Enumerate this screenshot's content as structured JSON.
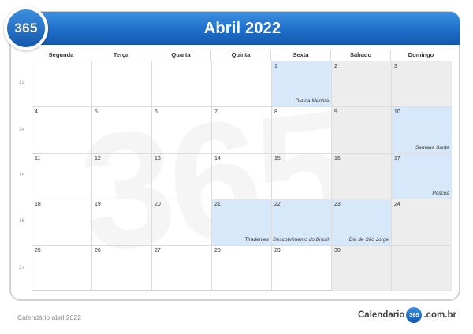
{
  "header": {
    "title": "Abril 2022",
    "logo_number": "365",
    "brand_color": "#1f6fcb"
  },
  "watermark": {
    "text": "365"
  },
  "weekdays": [
    "Segunda",
    "Terça",
    "Quarta",
    "Quinta",
    "Sexta",
    "Sábado",
    "Domingo"
  ],
  "weeks": [
    {
      "number": "13",
      "days": [
        {
          "day": "",
          "type": "empty",
          "event": ""
        },
        {
          "day": "",
          "type": "empty",
          "event": ""
        },
        {
          "day": "",
          "type": "empty",
          "event": ""
        },
        {
          "day": "",
          "type": "empty",
          "event": ""
        },
        {
          "day": "1",
          "type": "holiday",
          "event": "Dia da Mentira"
        },
        {
          "day": "2",
          "type": "weekend",
          "event": ""
        },
        {
          "day": "3",
          "type": "weekend",
          "event": ""
        }
      ]
    },
    {
      "number": "14",
      "days": [
        {
          "day": "4",
          "type": "normal",
          "event": ""
        },
        {
          "day": "5",
          "type": "normal",
          "event": ""
        },
        {
          "day": "6",
          "type": "normal",
          "event": ""
        },
        {
          "day": "7",
          "type": "normal",
          "event": ""
        },
        {
          "day": "8",
          "type": "normal",
          "event": ""
        },
        {
          "day": "9",
          "type": "weekend",
          "event": ""
        },
        {
          "day": "10",
          "type": "holiday",
          "event": "Semana Santa"
        }
      ]
    },
    {
      "number": "15",
      "days": [
        {
          "day": "11",
          "type": "normal",
          "event": ""
        },
        {
          "day": "12",
          "type": "normal",
          "event": ""
        },
        {
          "day": "13",
          "type": "normal",
          "event": ""
        },
        {
          "day": "14",
          "type": "normal",
          "event": ""
        },
        {
          "day": "15",
          "type": "normal",
          "event": ""
        },
        {
          "day": "16",
          "type": "weekend",
          "event": ""
        },
        {
          "day": "17",
          "type": "holiday",
          "event": "Páscoa"
        }
      ]
    },
    {
      "number": "16",
      "days": [
        {
          "day": "18",
          "type": "normal",
          "event": ""
        },
        {
          "day": "19",
          "type": "normal",
          "event": ""
        },
        {
          "day": "20",
          "type": "normal",
          "event": ""
        },
        {
          "day": "21",
          "type": "holiday",
          "event": "Tiradentes"
        },
        {
          "day": "22",
          "type": "holiday",
          "event": "Descobrimento do Brasil"
        },
        {
          "day": "23",
          "type": "holiday",
          "event": "Dia de São Jorge"
        },
        {
          "day": "24",
          "type": "weekend",
          "event": ""
        }
      ]
    },
    {
      "number": "17",
      "days": [
        {
          "day": "25",
          "type": "normal",
          "event": ""
        },
        {
          "day": "26",
          "type": "normal",
          "event": ""
        },
        {
          "day": "27",
          "type": "normal",
          "event": ""
        },
        {
          "day": "28",
          "type": "normal",
          "event": ""
        },
        {
          "day": "29",
          "type": "normal",
          "event": ""
        },
        {
          "day": "30",
          "type": "weekend",
          "event": ""
        },
        {
          "day": "",
          "type": "weekend",
          "event": ""
        }
      ]
    }
  ],
  "footer": {
    "caption": "Calendário abril 2022",
    "brand_prefix": "Calendario",
    "brand_badge": "365",
    "brand_suffix": ".com.br"
  },
  "colors": {
    "holiday": "#d6e8fa",
    "weekend": "#ebebeb"
  }
}
